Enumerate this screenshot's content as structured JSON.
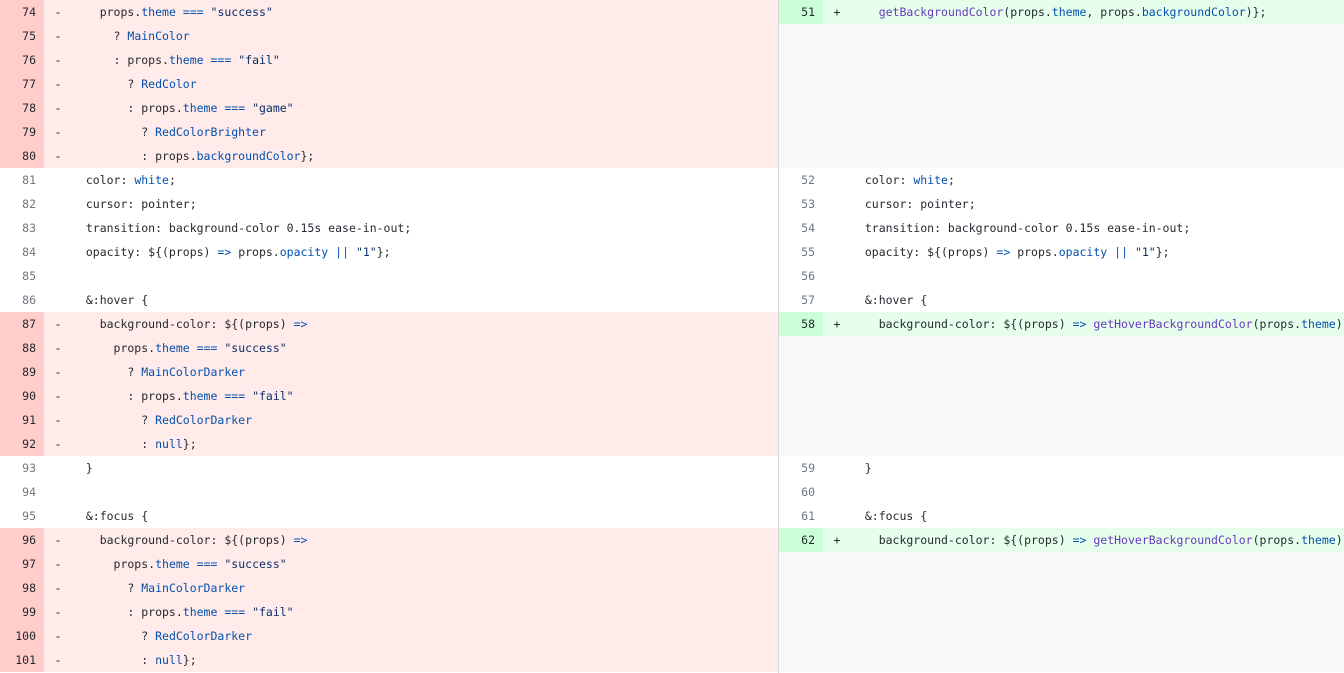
{
  "left": [
    {
      "type": "del",
      "num": "74",
      "mark": "-",
      "text": "    props.theme === \"success\""
    },
    {
      "type": "del",
      "num": "75",
      "mark": "-",
      "text": "      ? MainColor"
    },
    {
      "type": "del",
      "num": "76",
      "mark": "-",
      "text": "      : props.theme === \"fail\""
    },
    {
      "type": "del",
      "num": "77",
      "mark": "-",
      "text": "        ? RedColor"
    },
    {
      "type": "del",
      "num": "78",
      "mark": "-",
      "text": "        : props.theme === \"game\""
    },
    {
      "type": "del",
      "num": "79",
      "mark": "-",
      "text": "          ? RedColorBrighter"
    },
    {
      "type": "del",
      "num": "80",
      "mark": "-",
      "text": "          : props.backgroundColor};"
    },
    {
      "type": "ctx",
      "num": "81",
      "mark": "",
      "text": "  color: white;"
    },
    {
      "type": "ctx",
      "num": "82",
      "mark": "",
      "text": "  cursor: pointer;"
    },
    {
      "type": "ctx",
      "num": "83",
      "mark": "",
      "text": "  transition: background-color 0.15s ease-in-out;"
    },
    {
      "type": "ctx",
      "num": "84",
      "mark": "",
      "text": "  opacity: ${(props) => props.opacity || \"1\"};"
    },
    {
      "type": "ctx",
      "num": "85",
      "mark": "",
      "text": ""
    },
    {
      "type": "ctx",
      "num": "86",
      "mark": "",
      "text": "  &:hover {"
    },
    {
      "type": "del",
      "num": "87",
      "mark": "-",
      "text": "    background-color: ${(props) =>"
    },
    {
      "type": "del",
      "num": "88",
      "mark": "-",
      "text": "      props.theme === \"success\""
    },
    {
      "type": "del",
      "num": "89",
      "mark": "-",
      "text": "        ? MainColorDarker"
    },
    {
      "type": "del",
      "num": "90",
      "mark": "-",
      "text": "        : props.theme === \"fail\""
    },
    {
      "type": "del",
      "num": "91",
      "mark": "-",
      "text": "          ? RedColorDarker"
    },
    {
      "type": "del",
      "num": "92",
      "mark": "-",
      "text": "          : null};"
    },
    {
      "type": "ctx",
      "num": "93",
      "mark": "",
      "text": "  }"
    },
    {
      "type": "ctx",
      "num": "94",
      "mark": "",
      "text": ""
    },
    {
      "type": "ctx",
      "num": "95",
      "mark": "",
      "text": "  &:focus {"
    },
    {
      "type": "del",
      "num": "96",
      "mark": "-",
      "text": "    background-color: ${(props) =>"
    },
    {
      "type": "del",
      "num": "97",
      "mark": "-",
      "text": "      props.theme === \"success\""
    },
    {
      "type": "del",
      "num": "98",
      "mark": "-",
      "text": "        ? MainColorDarker"
    },
    {
      "type": "del",
      "num": "99",
      "mark": "-",
      "text": "        : props.theme === \"fail\""
    },
    {
      "type": "del",
      "num": "100",
      "mark": "-",
      "text": "          ? RedColorDarker"
    },
    {
      "type": "del",
      "num": "101",
      "mark": "-",
      "text": "          : null};"
    }
  ],
  "right": [
    {
      "type": "add",
      "num": "51",
      "mark": "+",
      "text": "    getBackgroundColor(props.theme, props.backgroundColor)};"
    },
    {
      "type": "empty",
      "num": "",
      "mark": "",
      "text": ""
    },
    {
      "type": "empty",
      "num": "",
      "mark": "",
      "text": ""
    },
    {
      "type": "empty",
      "num": "",
      "mark": "",
      "text": ""
    },
    {
      "type": "empty",
      "num": "",
      "mark": "",
      "text": ""
    },
    {
      "type": "empty",
      "num": "",
      "mark": "",
      "text": ""
    },
    {
      "type": "empty",
      "num": "",
      "mark": "",
      "text": ""
    },
    {
      "type": "ctx",
      "num": "52",
      "mark": "",
      "text": "  color: white;"
    },
    {
      "type": "ctx",
      "num": "53",
      "mark": "",
      "text": "  cursor: pointer;"
    },
    {
      "type": "ctx",
      "num": "54",
      "mark": "",
      "text": "  transition: background-color 0.15s ease-in-out;"
    },
    {
      "type": "ctx",
      "num": "55",
      "mark": "",
      "text": "  opacity: ${(props) => props.opacity || \"1\"};"
    },
    {
      "type": "ctx",
      "num": "56",
      "mark": "",
      "text": ""
    },
    {
      "type": "ctx",
      "num": "57",
      "mark": "",
      "text": "  &:hover {"
    },
    {
      "type": "add",
      "num": "58",
      "mark": "+",
      "text": "    background-color: ${(props) => getHoverBackgroundColor(props.theme)};"
    },
    {
      "type": "empty",
      "num": "",
      "mark": "",
      "text": ""
    },
    {
      "type": "empty",
      "num": "",
      "mark": "",
      "text": ""
    },
    {
      "type": "empty",
      "num": "",
      "mark": "",
      "text": ""
    },
    {
      "type": "empty",
      "num": "",
      "mark": "",
      "text": ""
    },
    {
      "type": "empty",
      "num": "",
      "mark": "",
      "text": ""
    },
    {
      "type": "ctx",
      "num": "59",
      "mark": "",
      "text": "  }"
    },
    {
      "type": "ctx",
      "num": "60",
      "mark": "",
      "text": ""
    },
    {
      "type": "ctx",
      "num": "61",
      "mark": "",
      "text": "  &:focus {"
    },
    {
      "type": "add",
      "num": "62",
      "mark": "+",
      "text": "    background-color: ${(props) => getHoverBackgroundColor(props.theme)};"
    },
    {
      "type": "empty",
      "num": "",
      "mark": "",
      "text": ""
    },
    {
      "type": "empty",
      "num": "",
      "mark": "",
      "text": ""
    },
    {
      "type": "empty",
      "num": "",
      "mark": "",
      "text": ""
    },
    {
      "type": "empty",
      "num": "",
      "mark": "",
      "text": ""
    },
    {
      "type": "empty",
      "num": "",
      "mark": "",
      "text": ""
    }
  ]
}
